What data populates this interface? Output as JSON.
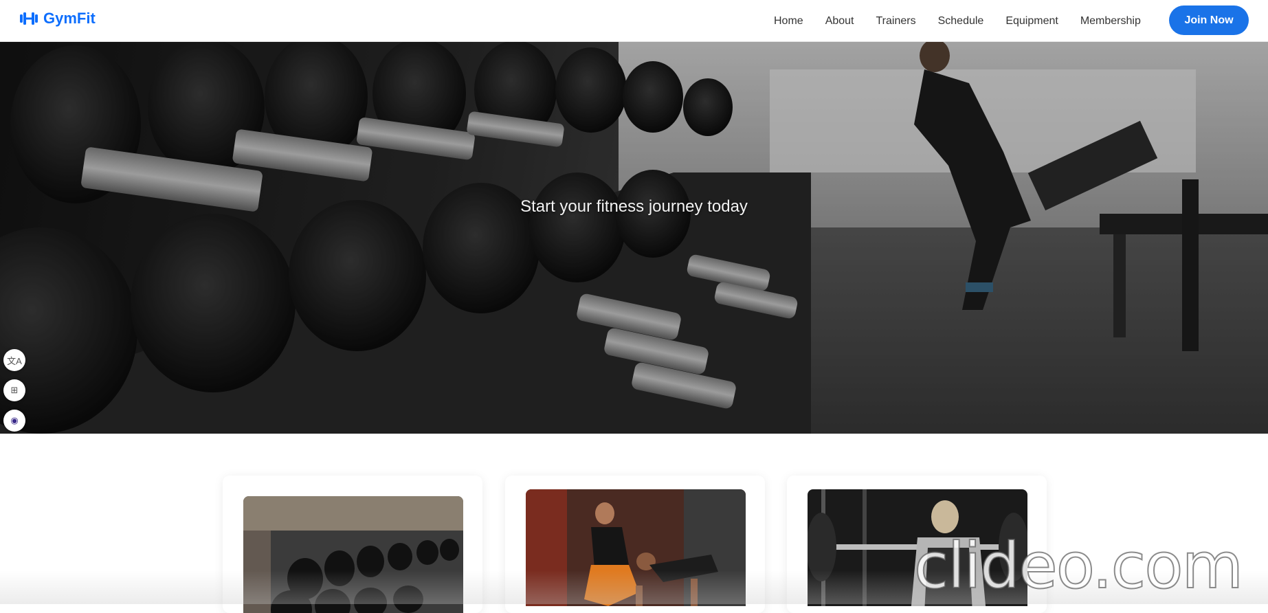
{
  "brand": {
    "name": "GymFit",
    "icon": "dumbbell-icon",
    "color": "#0d6efd"
  },
  "nav": {
    "links": [
      {
        "label": "Home"
      },
      {
        "label": "About"
      },
      {
        "label": "Trainers"
      },
      {
        "label": "Schedule"
      },
      {
        "label": "Equipment"
      },
      {
        "label": "Membership"
      }
    ],
    "cta_label": "Join Now",
    "cta_color": "#1a73e8"
  },
  "hero": {
    "tagline": "Start your fitness journey today",
    "image": "gym-dumbbell-rack-photo"
  },
  "side_tools": [
    {
      "icon": "translate-icon",
      "glyph": "文A"
    },
    {
      "icon": "apps-grid-icon",
      "glyph": "⊞"
    },
    {
      "icon": "assistant-bot-icon",
      "glyph": "◉"
    }
  ],
  "cards": [
    {
      "image": "dumbbell-rack-photo"
    },
    {
      "image": "personal-trainer-pushup-photo"
    },
    {
      "image": "barbell-squat-photo"
    }
  ],
  "watermark": "clideo.com"
}
